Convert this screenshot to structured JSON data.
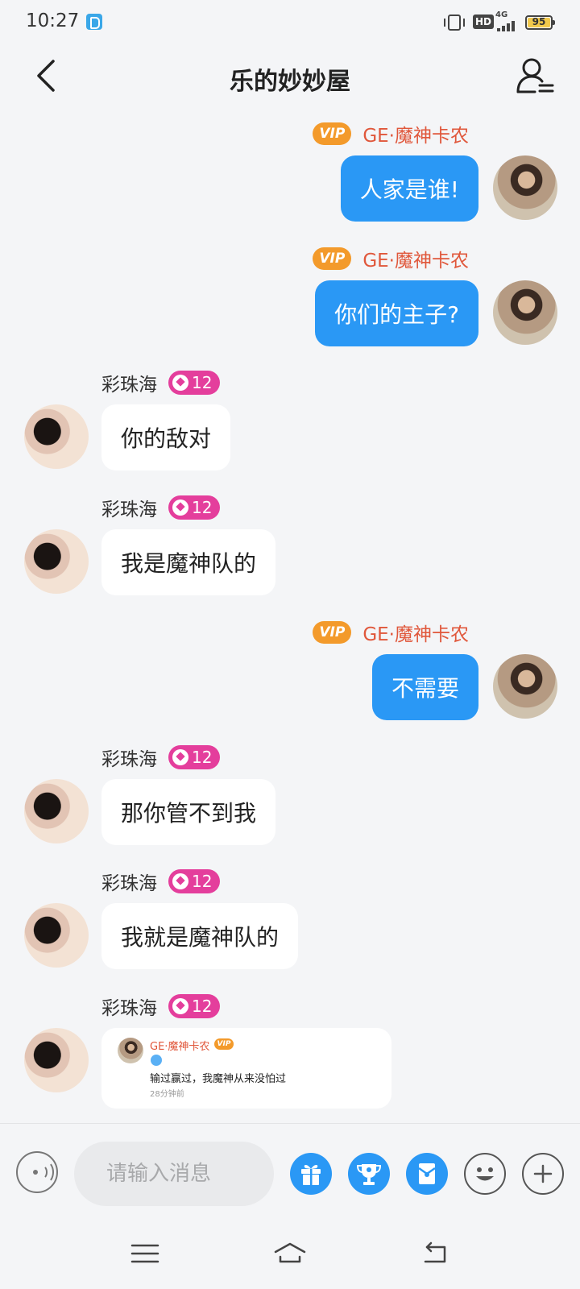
{
  "status_bar": {
    "time": "10:27",
    "network": "4G",
    "battery": "95"
  },
  "header": {
    "title": "乐的妙妙屋"
  },
  "labels": {
    "vip": "VIP"
  },
  "messages": [
    {
      "side": "me",
      "sender": "GE·魔神卡农",
      "text": "人家是谁!"
    },
    {
      "side": "me",
      "sender": "GE·魔神卡农",
      "text": "你们的主子?"
    },
    {
      "side": "other",
      "sender": "彩珠海",
      "level": "12",
      "text": "你的敌对"
    },
    {
      "side": "other",
      "sender": "彩珠海",
      "level": "12",
      "text": "我是魔神队的"
    },
    {
      "side": "me",
      "sender": "GE·魔神卡农",
      "text": "不需要"
    },
    {
      "side": "other",
      "sender": "彩珠海",
      "level": "12",
      "text": "那你管不到我"
    },
    {
      "side": "other",
      "sender": "彩珠海",
      "level": "12",
      "text": "我就是魔神队的"
    },
    {
      "side": "other",
      "sender": "彩珠海",
      "level": "12",
      "quote": {
        "name": "GE·魔神卡农",
        "text": "输过赢过，我魔神从来没怕过",
        "time": "28分钟前"
      }
    }
  ],
  "input": {
    "placeholder": "请输入消息"
  },
  "colors": {
    "my_bubble": "#2a98f5",
    "vip_badge": "#f39a2b",
    "my_name": "#e0573b",
    "level_badge": "#e43e9c"
  }
}
